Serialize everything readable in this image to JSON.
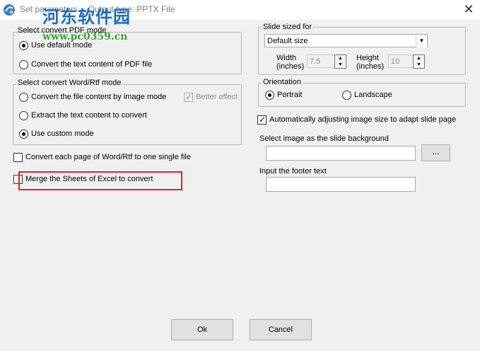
{
  "window": {
    "title": "Set parameters -- Output type: PPTX File",
    "close_glyph": "✕"
  },
  "watermark": {
    "text": "河东软件园",
    "url": "www.pc0359.cn"
  },
  "pdf_group": {
    "legend": "Select convert PDF mode",
    "options": [
      "Use default mode",
      "Convert the text content of PDF file"
    ],
    "selected": 0
  },
  "word_group": {
    "legend": "Select convert Word/Rtf mode",
    "options": [
      "Convert the file content by image mode",
      "Extract the text content to convert",
      "Use custom mode"
    ],
    "selected": 2,
    "better_effect": "Better effect"
  },
  "convert_each_page": "Convert each page of Word/Rtf to one single file",
  "merge_excel": "Merge the Sheets of Excel to convert",
  "slide_size": {
    "legend": "Slide sized for",
    "selected": "Default size",
    "width_label": "Width\n(inches)",
    "width_value": "7.5",
    "height_label": "Height\n(inches)",
    "height_value": "10"
  },
  "orientation": {
    "legend": "Orientation",
    "options": [
      "Portrait",
      "Landscape"
    ],
    "selected": 0
  },
  "auto_adjust": "Automatically adjusting image size to adapt slide page",
  "background_image": {
    "label": "Select image as the slide background",
    "value": "",
    "browse_label": "..."
  },
  "footer": {
    "label": "Input the footer text",
    "value": ""
  },
  "buttons": {
    "ok": "Ok",
    "cancel": "Cancel"
  },
  "colors": {
    "highlight": "#e8202a",
    "watermark_blue": "#1b6cc2",
    "watermark_green": "#3aa335"
  }
}
